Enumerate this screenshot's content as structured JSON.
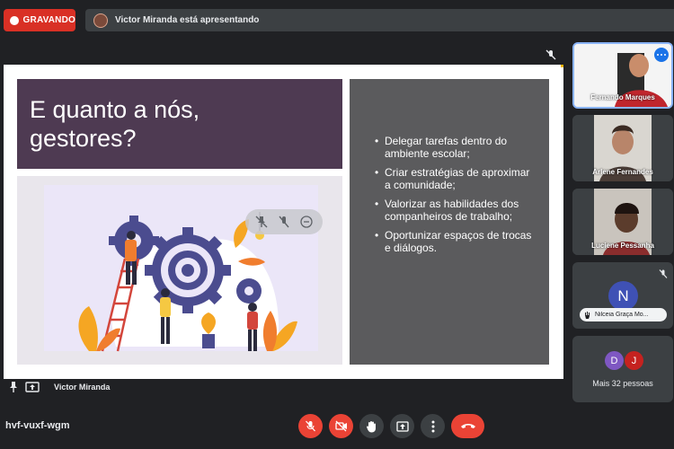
{
  "recording": {
    "label": "GRAVANDO"
  },
  "presenting_banner": {
    "text": "Victor Miranda está apresentando"
  },
  "slide": {
    "title_line1": "E quanto a nós,",
    "title_line2": "gestores?",
    "bullets": [
      "Delegar tarefas dentro do ambiente escolar;",
      "Criar estratégias de aproximar a comunidade;",
      "Valorizar as habilidades dos companheiros de trabalho;",
      "Oportunizar espaços de trocas e diálogos."
    ]
  },
  "presenter": {
    "name": "Victor Miranda"
  },
  "participants": [
    {
      "name": "Fernando Marques"
    },
    {
      "name": "Arlene Fernandes"
    },
    {
      "name": "Luciene Pessanha"
    },
    {
      "name": "Nilceia Graça Mo...",
      "initial": "N"
    }
  ],
  "more_tile": {
    "initials": [
      "D",
      "J"
    ],
    "text": "Mais 32 pessoas"
  },
  "meeting": {
    "code": "hvf-vuxf-wgm"
  },
  "colors": {
    "record_red": "#d93025",
    "control_red": "#ea4335",
    "slide_purple": "#4e3a52",
    "slide_gray": "#5b5b5d",
    "accent_blue": "#8ab4f8"
  },
  "icons": {
    "controls": [
      "mic-off-icon",
      "camera-off-icon",
      "raise-hand-icon",
      "present-screen-icon",
      "more-options-icon",
      "end-call-icon"
    ]
  }
}
